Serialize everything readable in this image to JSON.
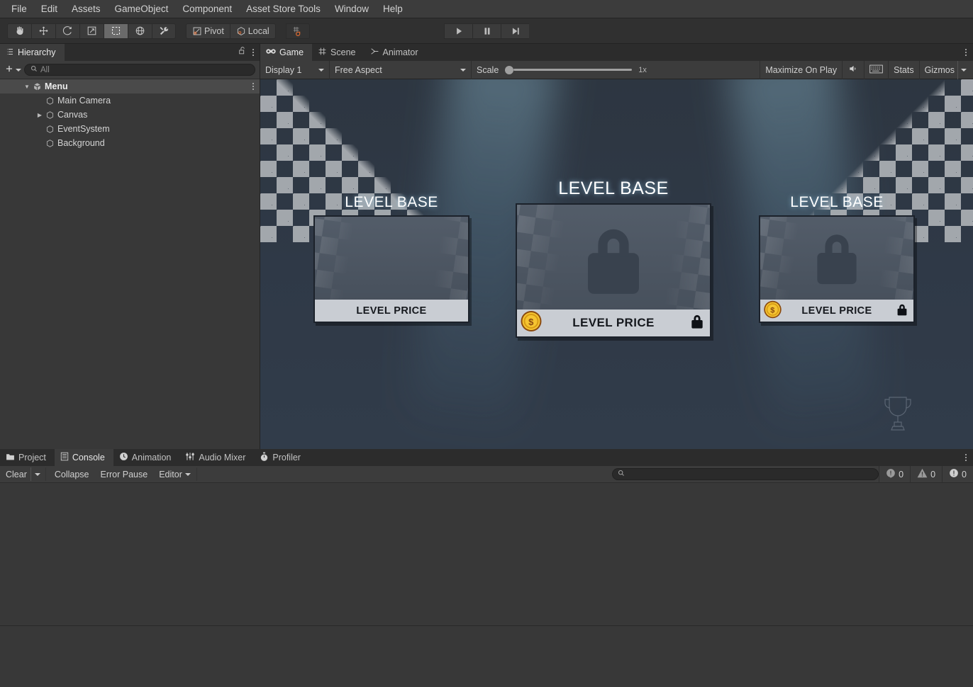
{
  "menubar": {
    "items": [
      "File",
      "Edit",
      "Assets",
      "GameObject",
      "Component",
      "Asset Store Tools",
      "Window",
      "Help"
    ]
  },
  "toolbar": {
    "tools": [
      {
        "name": "hand-tool",
        "icon": "hand-icon",
        "active": false
      },
      {
        "name": "move-tool",
        "icon": "move-icon",
        "active": false
      },
      {
        "name": "rotate-tool",
        "icon": "rotate-icon",
        "active": false
      },
      {
        "name": "scale-tool",
        "icon": "scale-icon",
        "active": false
      },
      {
        "name": "rect-tool",
        "icon": "rect-transform-icon",
        "active": true
      },
      {
        "name": "transform-tool",
        "icon": "transform-icon",
        "active": false
      },
      {
        "name": "custom-tool",
        "icon": "wrench-icon",
        "active": false
      }
    ],
    "pivot_label": "Pivot",
    "handle_label": "Local",
    "snap_label": "",
    "play_label": "play-icon",
    "pause_label": "pause-icon",
    "step_label": "step-icon"
  },
  "hierarchy": {
    "tab_label": "Hierarchy",
    "tab_icon": "hierarchy-icon",
    "lock_icon": "lock-open-icon",
    "menu_icon": "kebab-menu-icon",
    "create_label": "+",
    "search_placeholder": "All",
    "search_value": "",
    "items": [
      {
        "label": "Menu",
        "depth": 0,
        "expanded": true,
        "has_children": true,
        "selected": true,
        "icon": "scene-icon",
        "bold": true
      },
      {
        "label": "Main Camera",
        "depth": 1,
        "expanded": false,
        "has_children": false,
        "selected": false,
        "icon": "gameobject-icon",
        "bold": false
      },
      {
        "label": "Canvas",
        "depth": 1,
        "expanded": false,
        "has_children": true,
        "selected": false,
        "icon": "gameobject-icon",
        "bold": false
      },
      {
        "label": "EventSystem",
        "depth": 1,
        "expanded": false,
        "has_children": false,
        "selected": false,
        "icon": "gameobject-icon",
        "bold": false
      },
      {
        "label": "Background",
        "depth": 1,
        "expanded": false,
        "has_children": false,
        "selected": false,
        "icon": "gameobject-icon",
        "bold": false
      }
    ]
  },
  "gameview": {
    "tabs": [
      {
        "label": "Game",
        "icon": "gamepad-icon",
        "active": true
      },
      {
        "label": "Scene",
        "icon": "grid-icon",
        "active": false
      },
      {
        "label": "Animator",
        "icon": "animator-icon",
        "active": false
      }
    ],
    "menu_icon": "kebab-menu-icon",
    "display_label": "Display 1",
    "aspect_label": "Free Aspect",
    "scale_label": "Scale",
    "scale_value": "1x",
    "maximize_label": "Maximize On Play",
    "mute_icon": "speaker-icon",
    "stats_overlay_icon": "keyboard-icon",
    "stats_label": "Stats",
    "gizmos_label": "Gizmos"
  },
  "game_content": {
    "cards": [
      {
        "title": "LEVEL BASE",
        "price_label": "LEVEL PRICE",
        "has_coin": false,
        "has_lock_badge": false,
        "has_big_lock": false
      },
      {
        "title": "LEVEL BASE",
        "price_label": "LEVEL PRICE",
        "has_coin": true,
        "has_lock_badge": true,
        "has_big_lock": true
      },
      {
        "title": "LEVEL BASE",
        "price_label": "LEVEL PRICE",
        "has_coin": true,
        "has_lock_badge": true,
        "has_big_lock": true
      }
    ],
    "trophy_icon": "trophy-icon",
    "coin_symbol": "$",
    "colors": {
      "background": "#2f3947",
      "card_body": "#4c5663",
      "card_footer": "#c9cdd3",
      "coin_gold": "#f5c431",
      "title_text": "#ffffff"
    }
  },
  "bottomdock": {
    "tabs": [
      {
        "label": "Project",
        "icon": "folder-icon",
        "active": false
      },
      {
        "label": "Console",
        "icon": "console-icon",
        "active": true
      },
      {
        "label": "Animation",
        "icon": "clock-icon",
        "active": false
      },
      {
        "label": "Audio Mixer",
        "icon": "sliders-icon",
        "active": false
      },
      {
        "label": "Profiler",
        "icon": "stopwatch-icon",
        "active": false
      }
    ],
    "menu_icon": "kebab-menu-icon",
    "console": {
      "clear_label": "Clear",
      "collapse_label": "Collapse",
      "error_pause_label": "Error Pause",
      "editor_label": "Editor",
      "search_placeholder": "",
      "search_value": "",
      "counters": [
        {
          "name": "log-count",
          "icon": "info-icon",
          "value": "0"
        },
        {
          "name": "warning-count",
          "icon": "warning-icon",
          "value": "0"
        },
        {
          "name": "error-count",
          "icon": "error-icon",
          "value": "0"
        }
      ]
    }
  }
}
